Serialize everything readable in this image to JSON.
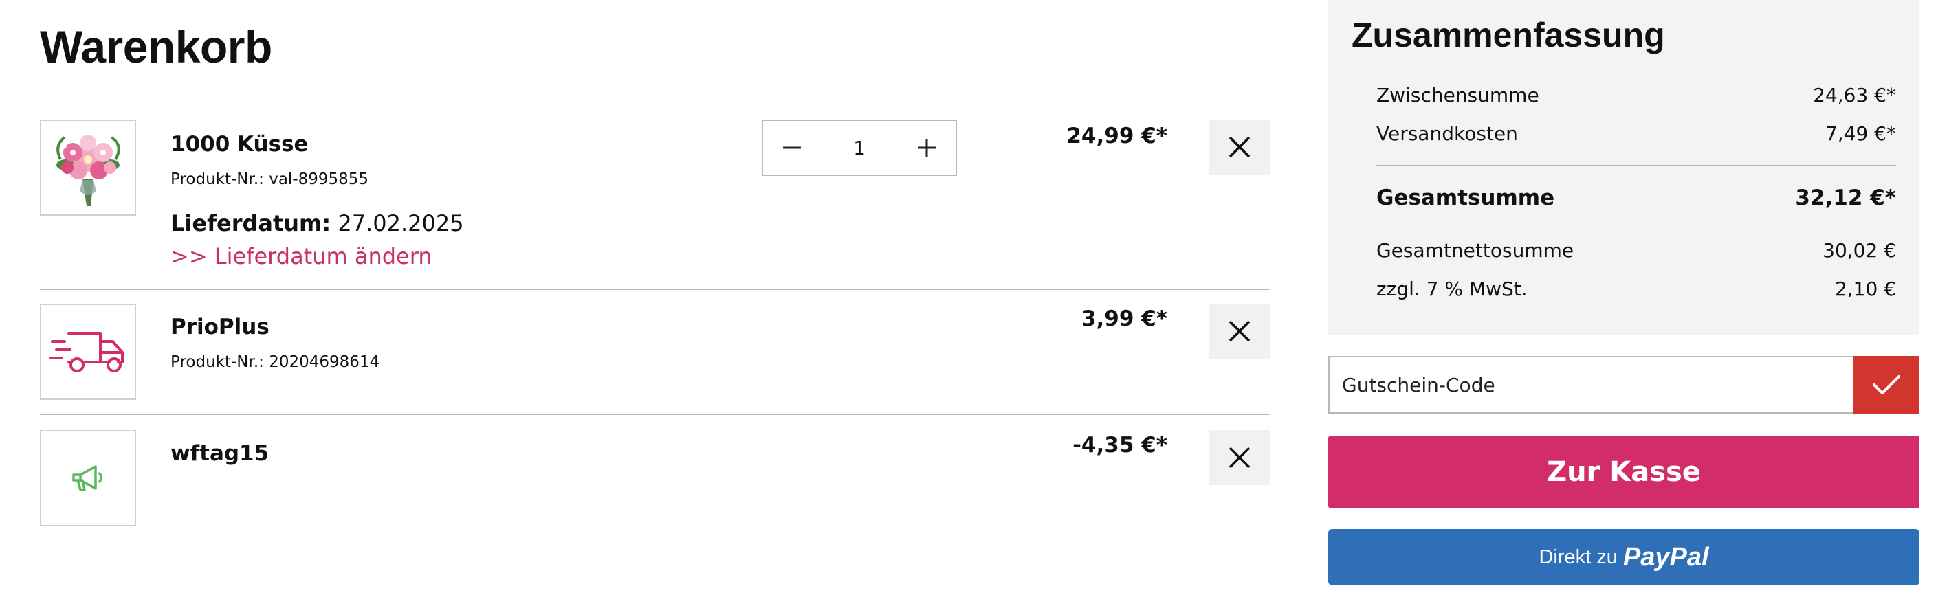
{
  "page": {
    "title": "Warenkorb"
  },
  "items": [
    {
      "name": "1000 Küsse",
      "product_number": "Produkt-Nr.: val-8995855",
      "delivery_label": "Lieferdatum:",
      "delivery_date": "27.02.2025",
      "change_link": ">> Lieferdatum ändern",
      "quantity": "1",
      "price": "24,99 €*",
      "thumb_icon": "bouquet-image"
    },
    {
      "name": "PrioPlus",
      "product_number": "Produkt-Nr.: 20204698614",
      "price": "3,99 €*",
      "thumb_icon": "fast-delivery-truck-icon"
    },
    {
      "name": "wftag15",
      "price": "-4,35 €*",
      "thumb_icon": "megaphone-icon"
    }
  ],
  "summary": {
    "title": "Zusammenfassung",
    "subtotal_label": "Zwischensumme",
    "subtotal_value": "24,63 €*",
    "shipping_label": "Versandkosten",
    "shipping_value": "7,49 €*",
    "total_label": "Gesamtsumme",
    "total_value": "32,12 €*",
    "net_label": "Gesamtnettosumme",
    "net_value": "30,02 €",
    "vat_label": "zzgl. 7 % MwSt.",
    "vat_value": "2,10 €"
  },
  "voucher": {
    "placeholder": "Gutschein-Code"
  },
  "checkout": {
    "label": "Zur Kasse"
  },
  "paypal": {
    "prefix": "Direkt zu",
    "brand": "PayPal"
  },
  "colors": {
    "accent_pink": "#d22d68",
    "link_pink": "#c8306b",
    "voucher_red": "#d2342e",
    "paypal_blue": "#2f6fb8",
    "promo_green": "#5cb85c",
    "summary_bg": "#f3f3f3"
  }
}
